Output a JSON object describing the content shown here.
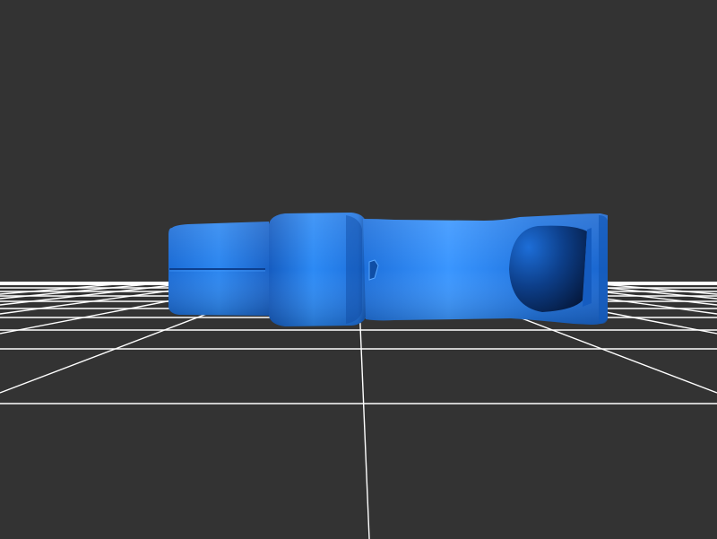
{
  "viewport": {
    "background_color": "#333333",
    "grid_color": "#ffffff",
    "model_color": "#1e78e6",
    "model_shadow_color": "#0a2a66",
    "model_highlight_color": "#3a96ff"
  },
  "model": {
    "shape": "whistle"
  }
}
